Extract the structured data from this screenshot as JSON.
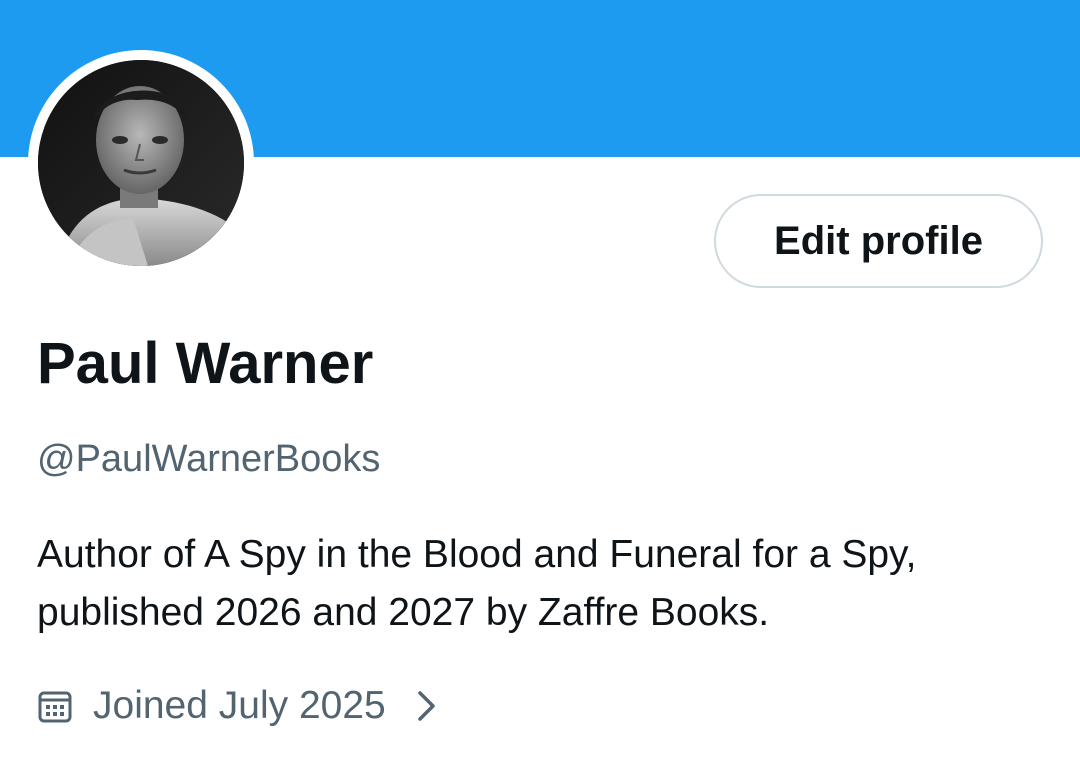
{
  "profile": {
    "display_name": "Paul Warner",
    "handle": "@PaulWarnerBooks",
    "bio": "Author of A Spy in the Blood and Funeral for a Spy, published 2026 and 2027 by Zaffre Books.",
    "joined": "Joined July 2025",
    "edit_label": "Edit profile",
    "joined_icon": "calendar-icon",
    "expand_icon": "chevron-right-icon"
  },
  "colors": {
    "banner": "#1d9bf0",
    "primary_text": "#0f1419",
    "secondary_text": "#536471",
    "button_border": "#cfd9de"
  }
}
